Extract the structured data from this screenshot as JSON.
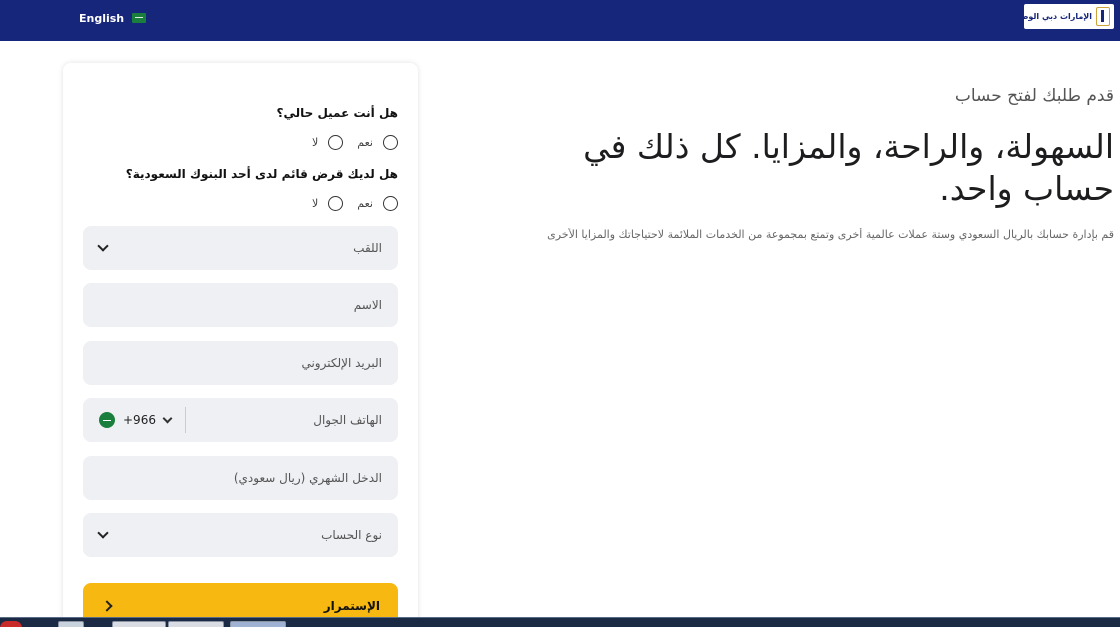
{
  "header": {
    "language_label": "English",
    "logo_text": "الإمارات دبي الوطني",
    "colors": {
      "header_bg": "#16267a",
      "accent": "#f7b812"
    }
  },
  "hero": {
    "subtitle": "قدم طلبك لفتح حساب",
    "title": "السهولة، والراحة، والمزايا. كل ذلك في حساب واحد.",
    "description": "قم بإدارة حسابك بالريال السعودي وستة عملات عالمية أخرى وتمتع بمجموعة من الخدمات الملائمة لاحتياجاتك والمزايا الأخرى"
  },
  "form": {
    "q1": {
      "label": "هل أنت عميل حالي؟",
      "yes": "نعم",
      "no": "لا"
    },
    "q2": {
      "label": "هل لديك قرض قائم لدى أحد البنوك السعودية؟",
      "yes": "نعم",
      "no": "لا"
    },
    "title_select": "اللقب",
    "name_input": "الاسم",
    "email_input": "البريد الإلكتروني",
    "phone_input": "الهاتف الجوال",
    "phone_code": "+966",
    "income_input": "الدخل الشهري (ريال سعودي)",
    "account_type_select": "نوع الحساب",
    "continue_label": "الإستمرار"
  }
}
